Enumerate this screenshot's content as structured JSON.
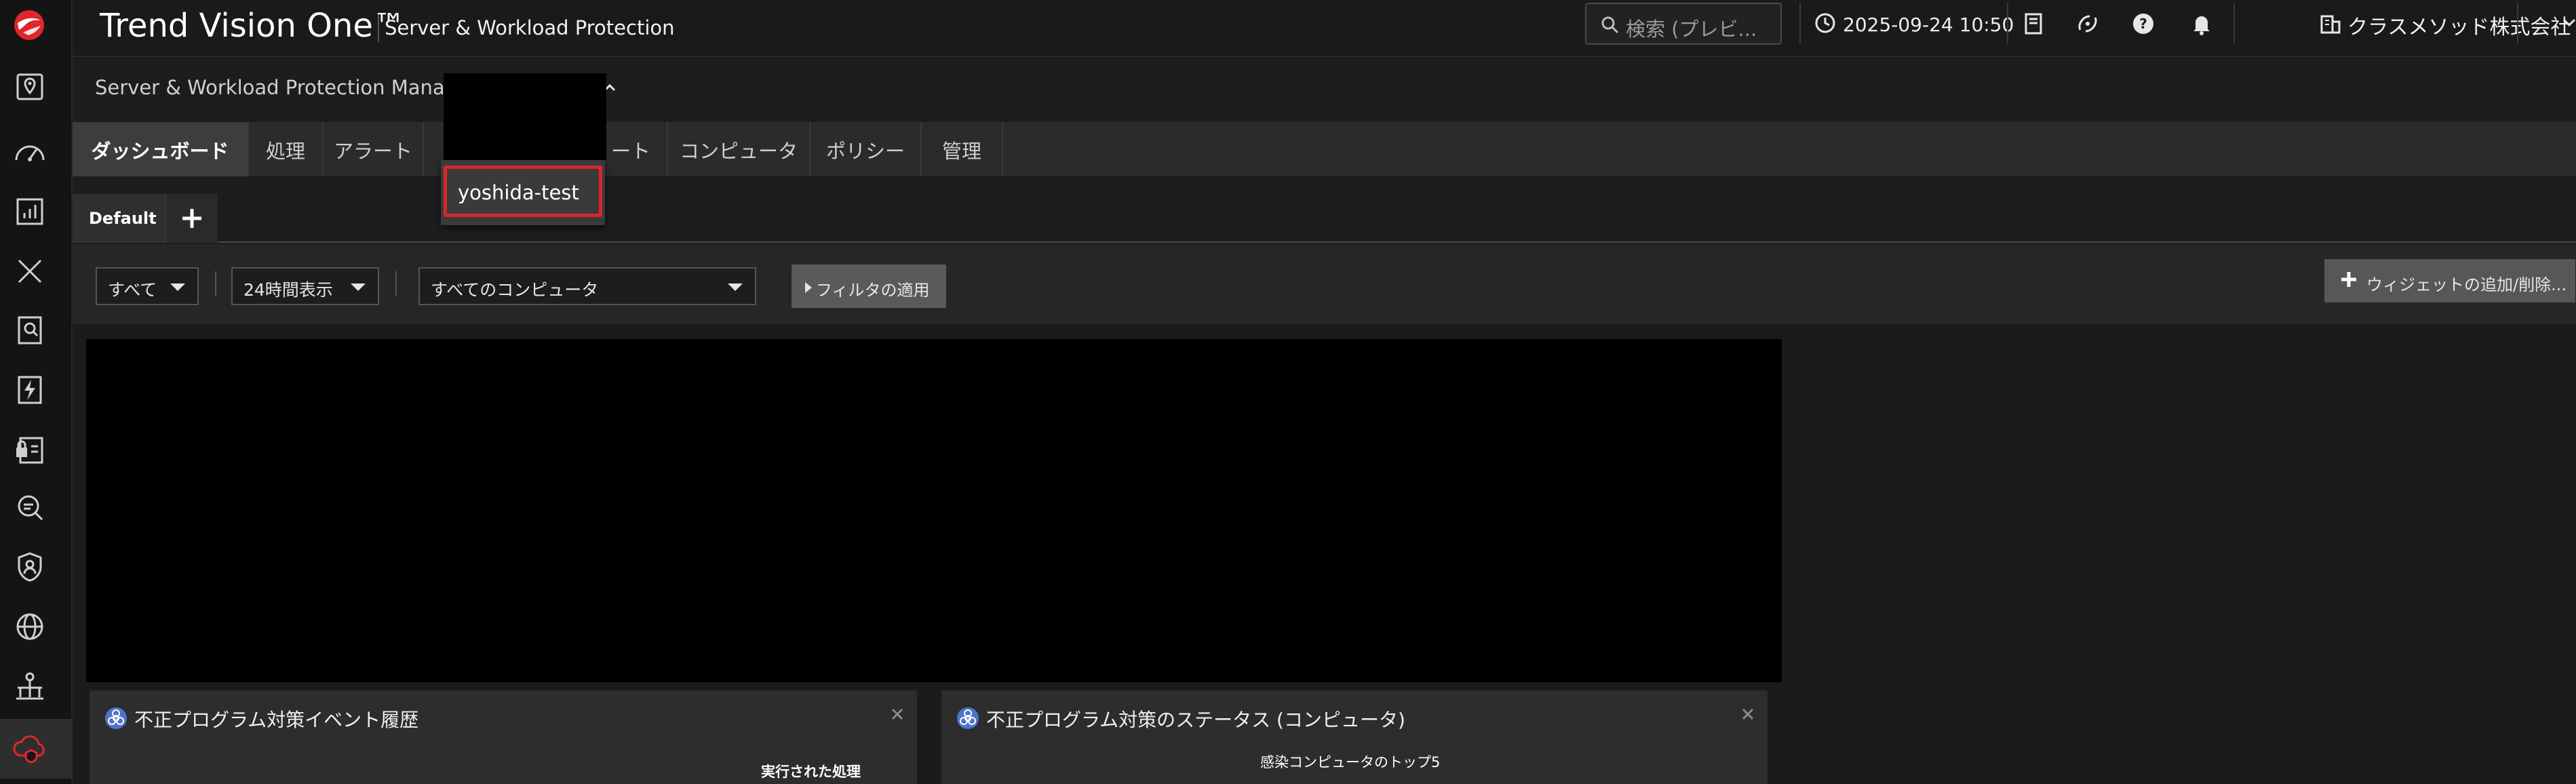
{
  "header": {
    "brand": "Trend Vision One™",
    "product": "Server & Workload Protection",
    "search_placeholder": "検索 (プレビ...",
    "datetime": "2025-09-24 10:50",
    "org": "クラスメソッド株式会社"
  },
  "sidebar": {
    "icons": [
      "map-pin-icon",
      "speedometer-icon",
      "report-chart-icon",
      "x-close-icon",
      "document-search-icon",
      "lightning-doc-icon",
      "lock-doc-icon",
      "magnifier-icon",
      "shield-user-icon",
      "globe-cycle-icon",
      "network-nodes-icon",
      "cloud-shield-icon"
    ]
  },
  "manager": {
    "label": "Server & Workload Protection Manager:"
  },
  "dropdown": {
    "item": "yoshida-test"
  },
  "main_tabs": [
    {
      "label": "ダッシュボード"
    },
    {
      "label": "処理"
    },
    {
      "label": "アラート"
    },
    {
      "label": "ート"
    },
    {
      "label": "コンピュータ"
    },
    {
      "label": "ポリシー"
    },
    {
      "label": "管理"
    }
  ],
  "sub_tabs": {
    "default_label": "Default"
  },
  "filters": {
    "scope": "すべて",
    "period": "24時間表示",
    "computers": "すべてのコンピュータ",
    "apply": "フィルタの適用",
    "add_widget": "ウィジェットの追加/削除..."
  },
  "widgets": [
    {
      "title": "不正プログラム対策イベント履歴",
      "subtitle": "実行された処理"
    },
    {
      "title": "不正プログラム対策のステータス (コンピュータ)",
      "subtitle": "感染コンピュータのトップ5"
    }
  ],
  "colors": {
    "highlight": "#d9262a",
    "brand_logo": "#e1262a",
    "widget_icon": "#4d74c9"
  }
}
